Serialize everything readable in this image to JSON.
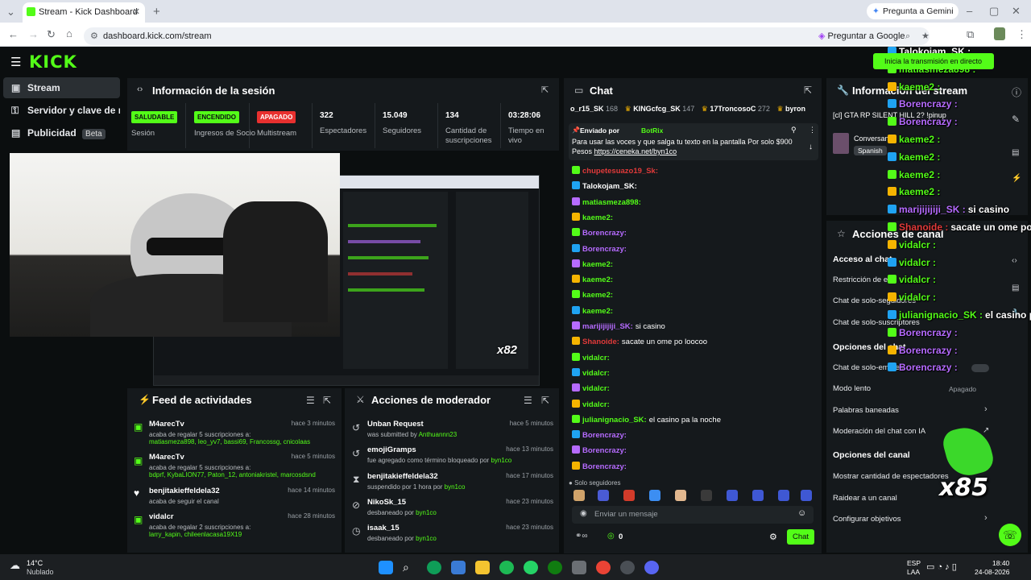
{
  "browser": {
    "tab_title": "Stream - Kick Dashboard",
    "url": "dashboard.kick.com/stream",
    "gemini_label": "Pregunta a Gemini",
    "google_label": "Preguntar a Google"
  },
  "sidebar": {
    "items": [
      {
        "label": "Stream",
        "icon": "stream-icon"
      },
      {
        "label": "Servidor y clave de retran",
        "icon": "key-icon"
      },
      {
        "label": "Publicidad",
        "icon": "ads-icon",
        "badge": "Beta"
      }
    ]
  },
  "session": {
    "title": "Información de la sesión",
    "stats": [
      {
        "badge": "SALUDABLE",
        "label": "Sesión"
      },
      {
        "badge": "ENCENDIDO",
        "label": "Ingresos de Socio"
      },
      {
        "badge": "APAGADO",
        "label": "Multistream"
      },
      {
        "value": "322",
        "label": "Espectadores"
      },
      {
        "value": "15.049",
        "label": "Seguidores"
      },
      {
        "value": "134",
        "label": "Cantidad de suscripciones"
      },
      {
        "value": "03:28:06",
        "label": "Tiempo en vivo"
      }
    ]
  },
  "feed": {
    "title": "Feed de actividades",
    "items": [
      {
        "name": "M4arecTv",
        "time": "hace 3 minutos",
        "desc": "acaba de regalar 5 suscripciones a:",
        "users": "matiasmeza898, leo_yv7, bassi69, Francossg, cnicolaas"
      },
      {
        "name": "M4arecTv",
        "time": "hace 5 minutos",
        "desc": "acaba de regalar 5 suscripciones a:",
        "users": "bdprf, KybaLION77, Paton_12, antoniakristel, marcosdsnd"
      },
      {
        "name": "benjitakieffeldela32",
        "time": "hace 14 minutos",
        "desc": "acaba de seguir el canal",
        "users": ""
      },
      {
        "name": "vidalcr",
        "time": "hace 28 minutos",
        "desc": "acaba de regalar 2 suscripciones a:",
        "users": "larry_kapin, chileenlacasa19X19"
      }
    ]
  },
  "moderator": {
    "title": "Acciones de moderador",
    "items": [
      {
        "name": "Unban Request",
        "time": "hace 5 minutos",
        "desc": "was submitted by ",
        "by": "Anthuannn23"
      },
      {
        "name": "emojiGramps",
        "time": "hace 13 minutos",
        "desc": "fue agregado como término bloqueado por ",
        "by": "byn1co"
      },
      {
        "name": "benjitakieffeldela32",
        "time": "hace 17 minutos",
        "desc": "suspendido por 1 hora por ",
        "by": "byn1co"
      },
      {
        "name": "NikoSk_15",
        "time": "hace 23 minutos",
        "desc": "desbaneado por ",
        "by": "byn1co"
      },
      {
        "name": "isaak_15",
        "time": "hace 23 minutos",
        "desc": "desbaneado por ",
        "by": "byn1co"
      }
    ]
  },
  "chat": {
    "title": "Chat",
    "top_gifters": [
      {
        "name": "o_r15_SK",
        "count": "168"
      },
      {
        "name": "KINGcfcg_SK",
        "count": "147"
      },
      {
        "name": "17TroncosoC",
        "count": "272"
      },
      {
        "name": "byron",
        "count": ""
      }
    ],
    "pinned_by": "Enviado por",
    "pinned_user": "BotRix",
    "pinned_text": "Para usar las voces y que salga tu texto en la pantalla Por solo $900 Pesos",
    "pinned_link": "https://ceneka.net/byn1co",
    "messages": [
      {
        "user": "chupetesuazo19_Sk:",
        "text": "",
        "color": "#e03a3a"
      },
      {
        "user": "Talokojam_SK:",
        "text": "",
        "color": "#ffffff"
      },
      {
        "user": "matiasmeza898:",
        "text": "",
        "color": "#53fc18"
      },
      {
        "user": "kaeme2:",
        "text": "",
        "color": "#53fc18"
      },
      {
        "user": "Borencrazy:",
        "text": "",
        "color": "#b66bff"
      },
      {
        "user": "Borencrazy:",
        "text": "",
        "color": "#b66bff"
      },
      {
        "user": "kaeme2:",
        "text": "",
        "color": "#53fc18"
      },
      {
        "user": "kaeme2:",
        "text": "",
        "color": "#53fc18"
      },
      {
        "user": "kaeme2:",
        "text": "",
        "color": "#53fc18"
      },
      {
        "user": "kaeme2:",
        "text": "",
        "color": "#53fc18"
      },
      {
        "user": "marijijijiji_SK:",
        "text": "si casino",
        "color": "#b66bff"
      },
      {
        "user": "Shanoide:",
        "text": "sacate un ome po loocoo",
        "color": "#e03a3a"
      },
      {
        "user": "vidalcr:",
        "text": "",
        "color": "#53fc18"
      },
      {
        "user": "vidalcr:",
        "text": "",
        "color": "#53fc18"
      },
      {
        "user": "vidalcr:",
        "text": "",
        "color": "#53fc18"
      },
      {
        "user": "vidalcr:",
        "text": "",
        "color": "#53fc18"
      },
      {
        "user": "julianignacio_SK:",
        "text": "el casino pa la noche",
        "color": "#53fc18"
      },
      {
        "user": "Borencrazy:",
        "text": "",
        "color": "#b66bff"
      },
      {
        "user": "Borencrazy:",
        "text": "",
        "color": "#b66bff"
      },
      {
        "user": "Borencrazy:",
        "text": "",
        "color": "#b66bff"
      }
    ],
    "followers_only": "Solo seguidores",
    "input_placeholder": "Enviar un mensaje",
    "points": "0",
    "send_label": "Chat"
  },
  "stream_info": {
    "title": "Información del stream",
    "stream_title": "[cl] GTA RP SILENT HILL 2? !pinup",
    "category": "Conversan",
    "language": "Spanish"
  },
  "channel_actions": {
    "title": "Acciones de canal",
    "chat_access_title": "Acceso al chat",
    "rows1": [
      {
        "label": "Restricción de ed"
      },
      {
        "label": "Chat de solo-seguidores"
      },
      {
        "label": "Chat de solo-suscriptores"
      }
    ],
    "chat_options_title": "Opciones del chat",
    "rows2": [
      {
        "label": "Chat de solo-emotes"
      },
      {
        "label": "Modo lento",
        "value": "Apagado"
      },
      {
        "label": "Palabras baneadas"
      },
      {
        "label": "Moderación del chat con IA"
      }
    ],
    "channel_options_title": "Opciones del canal",
    "rows3": [
      {
        "label": "Mostrar cantidad de espectadores"
      },
      {
        "label": "Raidear a un canal"
      },
      {
        "label": "Configurar objetivos"
      }
    ]
  },
  "overlay": {
    "lines": [
      {
        "user": "Talokojam_SK :",
        "text": "",
        "color": "#ffffff"
      },
      {
        "user": "matiasmeza898 :",
        "text": "",
        "color": "#53fc18"
      },
      {
        "user": "kaeme2 :",
        "text": "",
        "color": "#53fc18"
      },
      {
        "user": "Borencrazy :",
        "text": "",
        "color": "#b66bff"
      },
      {
        "user": "Borencrazy :",
        "text": "",
        "color": "#b66bff"
      },
      {
        "user": "kaeme2 :",
        "text": "",
        "color": "#53fc18"
      },
      {
        "user": "kaeme2 :",
        "text": "",
        "color": "#53fc18"
      },
      {
        "user": "kaeme2 :",
        "text": "",
        "color": "#53fc18"
      },
      {
        "user": "kaeme2 :",
        "text": "",
        "color": "#53fc18"
      },
      {
        "user": "marijijijiji_SK :",
        "text": "si casino",
        "color": "#b66bff"
      },
      {
        "user": "Shanoide :",
        "text": "sacate un ome po loocoo",
        "color": "#e03a3a"
      },
      {
        "user": "vidalcr :",
        "text": "",
        "color": "#53fc18"
      },
      {
        "user": "vidalcr :",
        "text": "",
        "color": "#53fc18"
      },
      {
        "user": "vidalcr :",
        "text": "",
        "color": "#53fc18"
      },
      {
        "user": "vidalcr :",
        "text": "",
        "color": "#53fc18"
      },
      {
        "user": "julianignacio_SK :",
        "text": "el casino pa la noche",
        "color": "#53fc18"
      },
      {
        "user": "Borencrazy :",
        "text": "",
        "color": "#b66bff"
      },
      {
        "user": "Borencrazy :",
        "text": "",
        "color": "#b66bff"
      },
      {
        "user": "Borencrazy :",
        "text": "",
        "color": "#b66bff"
      }
    ],
    "start_stream": "Inicia la transmisión en directo",
    "combo": "x85",
    "screen_combo": "x82"
  },
  "taskbar": {
    "temp": "14°C",
    "weather": "Nublado",
    "lang1": "ESP",
    "lang2": "LAA",
    "time": "18:40",
    "date": "24-08-2026"
  },
  "colors": {
    "accent": "#53fc18",
    "panel": "#15191c",
    "background": "#0b0e0f"
  }
}
